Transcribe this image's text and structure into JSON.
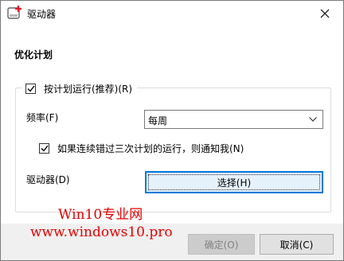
{
  "window": {
    "title": "驱动器",
    "close_icon": "close-icon"
  },
  "section": {
    "title": "优化计划"
  },
  "schedule": {
    "run_label": "按计划运行(推荐)(R)",
    "run_checked": true,
    "frequency_label": "频率(F)",
    "frequency_value": "每周",
    "notify_label": "如果连续错过三次计划的运行，则通知我(N)",
    "notify_checked": true,
    "drives_label": "驱动器(D)",
    "choose_button": "选择(H)"
  },
  "footer": {
    "ok_label": "确定(O)",
    "ok_enabled": false,
    "cancel_label": "取消(C)"
  },
  "watermark": {
    "line1": "Win10专业网",
    "line2": "www.windows10.pro"
  },
  "colors": {
    "accent": "#0078d7",
    "watermark": "#e60000"
  }
}
